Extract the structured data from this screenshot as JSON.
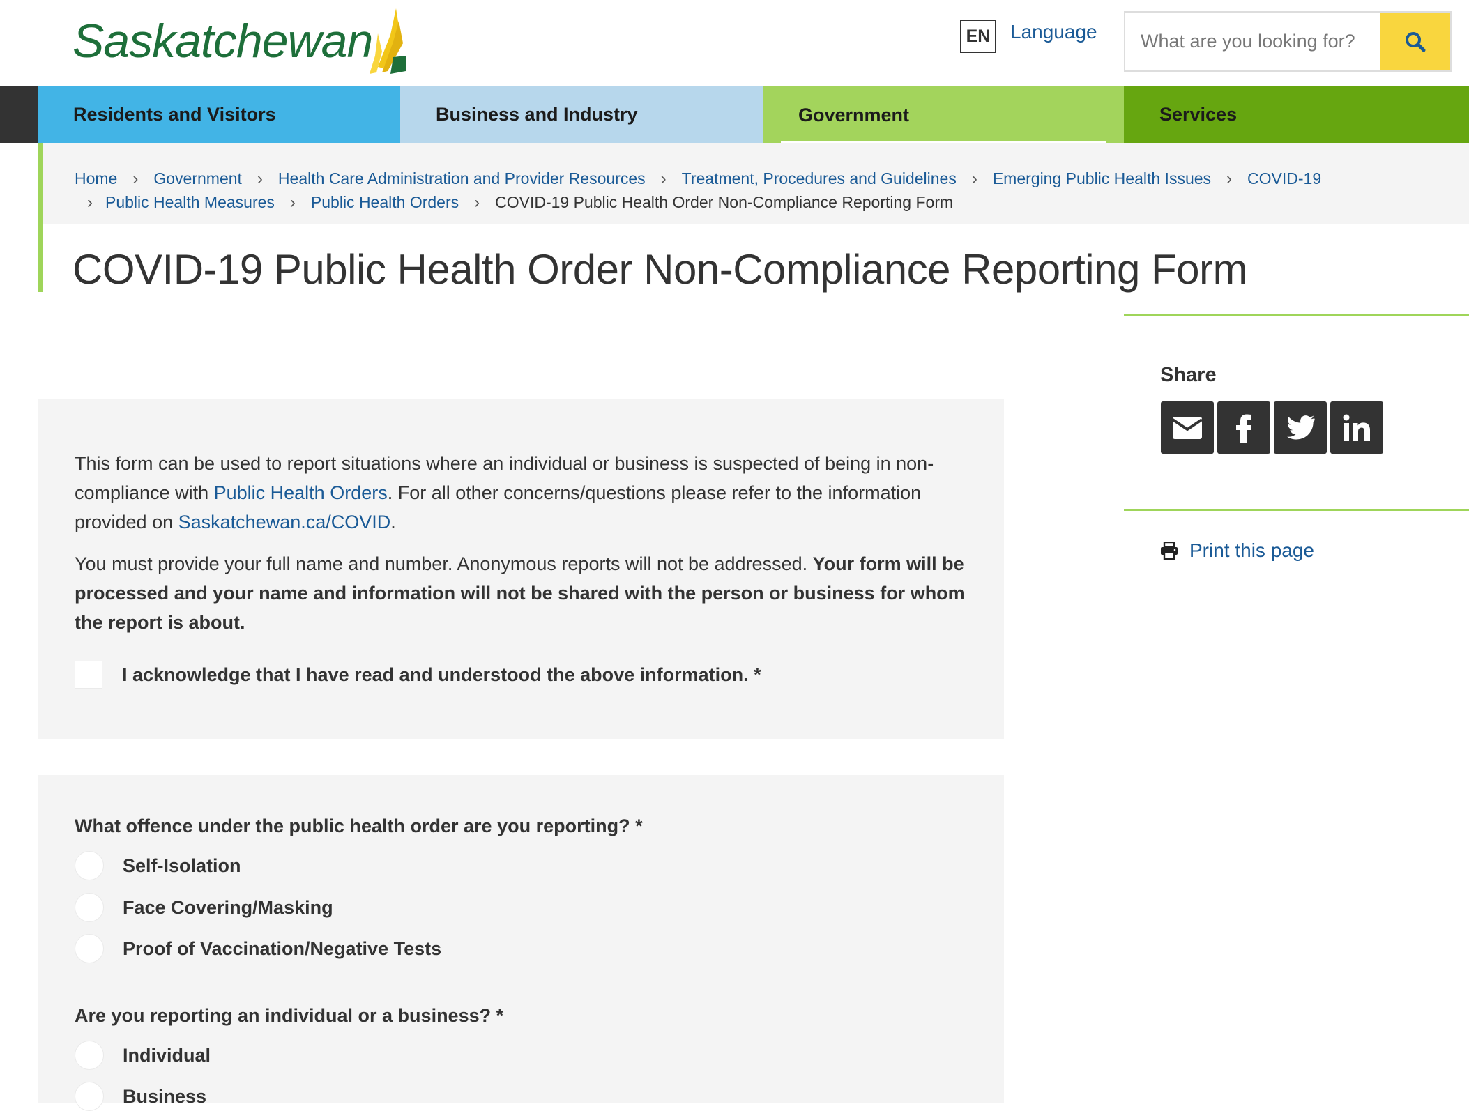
{
  "header": {
    "logo_text": "Saskatchewan",
    "lang_code": "EN",
    "lang_link": "Language",
    "search_placeholder": "What are you looking for?"
  },
  "nav": {
    "items": [
      {
        "label": "Residents and Visitors",
        "color": "#42b4e6"
      },
      {
        "label": "Business and Industry",
        "color": "#b7d7ec"
      },
      {
        "label": "Government",
        "color": "#a3d45c"
      },
      {
        "label": "Services",
        "color": "#66a610"
      }
    ]
  },
  "breadcrumb": {
    "items": [
      "Home",
      "Government",
      "Health Care Administration and Provider Resources",
      "Treatment, Procedures and Guidelines",
      "Emerging Public Health Issues",
      "COVID-19",
      "Public Health Measures",
      "Public Health Orders"
    ],
    "current": "COVID-19 Public Health Order Non-Compliance Reporting Form"
  },
  "page": {
    "title": "COVID-19 Public Health Order Non-Compliance Reporting Form"
  },
  "sidebar": {
    "share_title": "Share",
    "print_label": "Print this page"
  },
  "form": {
    "intro_1": "This form can be used to report situations where an individual or business is suspected of being in non-compliance with",
    "intro_link_1": "Public Health Orders",
    "intro_2": ". For all other concerns/questions please refer to the information provided on",
    "intro_link_2": "Saskatchewan.ca/COVID",
    "intro_3": ".",
    "notice_plain": "You must provide your full name and number. Anonymous reports will not be addressed.",
    "notice_bold": "Your form will be processed and your name and information will not be shared with the person or business for whom the report is about.",
    "acknowledge": "I acknowledge that I have read and understood the above information. *",
    "q1": {
      "label": "What offence under the public health order are you reporting? *",
      "options": [
        "Self-Isolation",
        "Face Covering/Masking",
        "Proof of Vaccination/Negative Tests"
      ]
    },
    "q2": {
      "label": "Are you reporting an individual or a business? *",
      "options": [
        "Individual",
        "Business"
      ]
    }
  }
}
